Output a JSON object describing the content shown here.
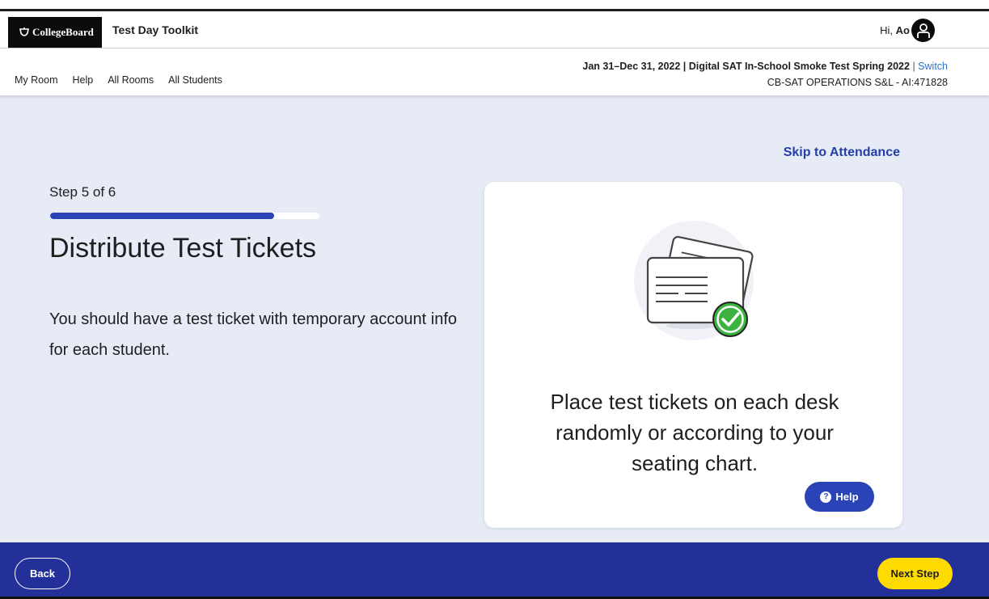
{
  "header": {
    "logo_text": "CollegeBoard",
    "app_title": "Test Day Toolkit",
    "greeting_prefix": "Hi, ",
    "user_name": "Ao"
  },
  "nav": {
    "links": [
      "My Room",
      "Help",
      "All Rooms",
      "All Students"
    ]
  },
  "context": {
    "event": "Jan 31–Dec 31, 2022 | Digital SAT In-School Smoke Test Spring 2022",
    "separator": " | ",
    "switch_label": "Switch",
    "organization": "CB-SAT OPERATIONS S&L - AI:471828"
  },
  "main": {
    "skip_label": "Skip to Attendance",
    "step_label": "Step 5 of 6",
    "progress_fraction": 0.833,
    "title": "Distribute Test Tickets",
    "description": "You should have a test ticket with temporary account info for each student.",
    "card_text": "Place test tickets on each desk randomly or according to your seating chart.",
    "help_label": "Help"
  },
  "footer": {
    "back_label": "Back",
    "next_label": "Next Step"
  },
  "colors": {
    "brand_blue": "#2a44b8",
    "footer_blue": "#24309a",
    "accent_yellow": "#fedb00",
    "check_green": "#3cb340",
    "background": "#e6ebf6"
  }
}
